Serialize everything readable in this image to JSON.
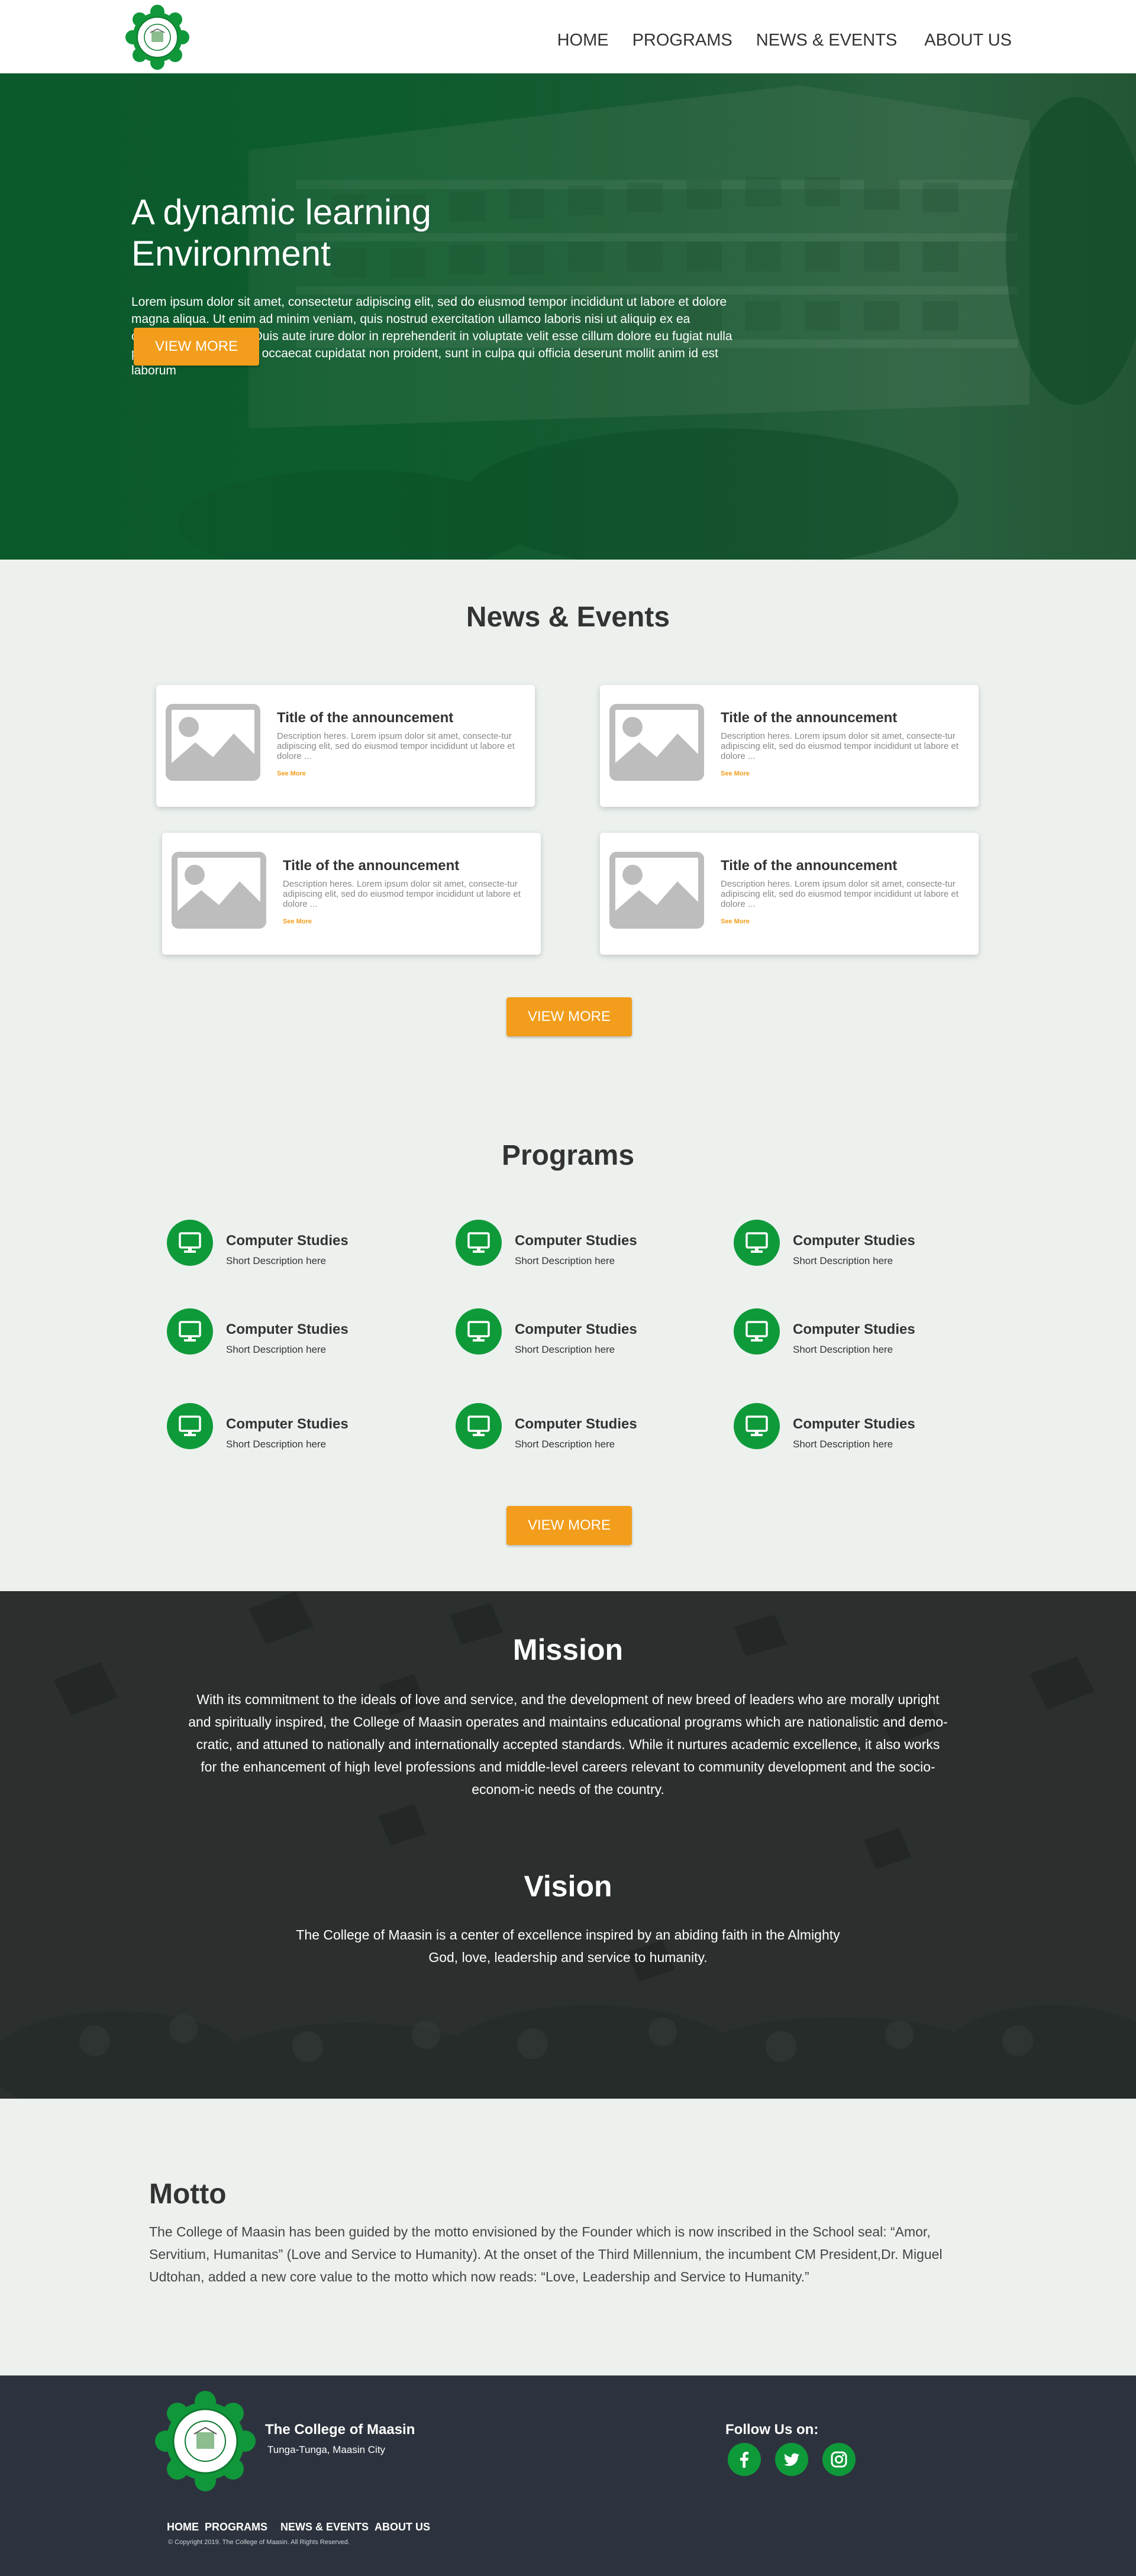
{
  "header": {
    "logo_alt": "The College of Maasin seal",
    "nav": [
      "HOME",
      "PROGRAMS",
      "NEWS & EVENTS",
      "ABOUT US"
    ]
  },
  "hero": {
    "title": "A dynamic learning Environment",
    "text": "Lorem ipsum dolor sit amet, consectetur adipiscing elit, sed do eiusmod tempor incididunt ut labore et dolore magna aliqua. Ut enim ad minim veniam, quis nostrud exercitation ullamco laboris nisi ut aliquip ex ea commodo consequat. Duis aute irure dolor in reprehenderit in voluptate velit esse cillum dolore eu fugiat nulla pariatur. Excepteur sint occaecat cupidatat non proident, sunt in culpa qui officia deserunt mollit anim id est laborum",
    "button": "VIEW MORE"
  },
  "news": {
    "title": "News & Events",
    "items": [
      {
        "title": "Title of the announcement",
        "desc": "Description heres. Lorem ipsum dolor sit amet, consecte-tur adipiscing elit, sed do eiusmod tempor incididunt ut labore et dolore ...",
        "more": "See More"
      },
      {
        "title": "Title of the announcement",
        "desc": "Description heres. Lorem ipsum dolor sit amet, consecte-tur adipiscing elit, sed do eiusmod tempor incididunt ut labore et dolore ...",
        "more": "See More"
      },
      {
        "title": "Title of the announcement",
        "desc": "Description heres. Lorem ipsum dolor sit amet, consecte-tur adipiscing elit, sed do eiusmod tempor incididunt ut labore et dolore ...",
        "more": "See More"
      },
      {
        "title": "Title of the announcement",
        "desc": "Description heres. Lorem ipsum dolor sit amet, consecte-tur adipiscing elit, sed do eiusmod tempor incididunt ut labore et dolore ...",
        "more": "See More"
      }
    ],
    "button": "VIEW MORE"
  },
  "programs": {
    "title": "Programs",
    "icon": "monitor-icon",
    "items": [
      {
        "name": "Computer Studies",
        "desc": "Short Description here"
      },
      {
        "name": "Computer Studies",
        "desc": "Short Description here"
      },
      {
        "name": "Computer Studies",
        "desc": "Short Description here"
      },
      {
        "name": "Computer Studies",
        "desc": "Short Description here"
      },
      {
        "name": "Computer Studies",
        "desc": "Short Description here"
      },
      {
        "name": "Computer Studies",
        "desc": "Short Description here"
      },
      {
        "name": "Computer Studies",
        "desc": "Short Description here"
      },
      {
        "name": "Computer Studies",
        "desc": "Short Description here"
      },
      {
        "name": "Computer Studies",
        "desc": "Short Description here"
      }
    ],
    "button": "VIEW MORE"
  },
  "mission": {
    "title": "Mission",
    "text": "With its commitment to the ideals of love and service, and the development of new breed of leaders who are morally upright and spiritually inspired, the College of Maasin operates and maintains educational programs which are nationalistic and demo-cratic, and attuned to nationally and internationally accepted standards. While it nurtures academic excellence, it also works for the enhancement of high level professions and middle-level careers relevant to community development and the socio-econom-ic needs of the country."
  },
  "vision": {
    "title": "Vision",
    "text": "The College of Maasin is a center of excellence inspired by an abiding faith in the Almighty God, love, leadership and service to humanity."
  },
  "motto": {
    "title": "Motto",
    "text": "The College of Maasin has been guided by the motto envisioned by the Founder which is now inscribed in the School seal: “Amor, Servitium, Humanitas” (Love and Service to Humanity). At the onset of the Third Millennium, the incumbent CM President,Dr. Miguel Udtohan, added a new core value to the motto which now reads: “Love, Leadership and Service to Humanity.”"
  },
  "footer": {
    "name": "The College of Maasin",
    "address": "Tunga-Tunga, Maasin City",
    "follow": "Follow Us on:",
    "social": [
      "facebook-icon",
      "twitter-icon",
      "instagram-icon"
    ],
    "nav": [
      "HOME",
      "PROGRAMS",
      "NEWS & EVENTS",
      "ABOUT US"
    ],
    "copyright": "© Copyright 2019. The College of Maasin. All Rights Reserved."
  },
  "colors": {
    "accent": "#f29d1b",
    "green": "#0f9a3a",
    "hero_green": "#0b5a2c",
    "footer": "#2d333e",
    "background": "#ecf1ee"
  }
}
